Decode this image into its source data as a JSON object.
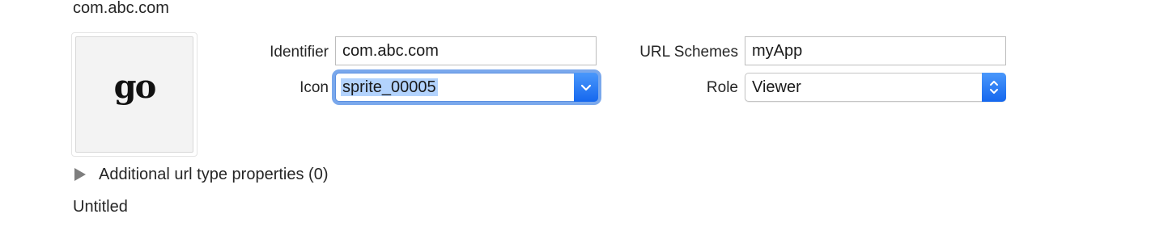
{
  "url_type": {
    "title": "com.abc.com",
    "icon_image_text": "go",
    "identifier_label": "Identifier",
    "identifier_value": "com.abc.com",
    "icon_label": "Icon",
    "icon_value": "sprite_00005",
    "url_schemes_label": "URL Schemes",
    "url_schemes_value": "myApp",
    "role_label": "Role",
    "role_value": "Viewer",
    "additional_properties_label": "Additional url type properties (0)"
  },
  "next_url_type": {
    "title": "Untitled"
  },
  "colors": {
    "accent": "#1a6ff0",
    "focus_ring": "#7aa8ec",
    "selection": "#b3d3fd"
  },
  "icons": [
    "chevron-down-icon",
    "up-down-chevron-icon",
    "disclosure-triangle-icon"
  ]
}
